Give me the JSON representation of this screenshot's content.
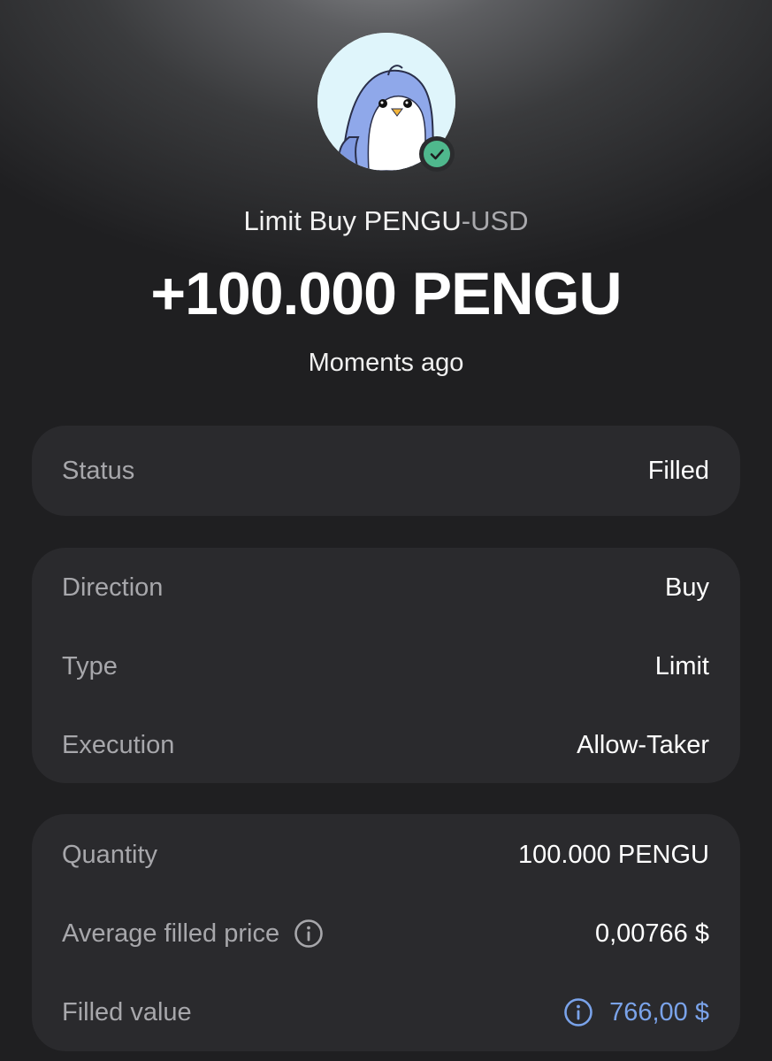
{
  "header": {
    "avatar_icon": "pengu-penguin-avatar",
    "verified_icon": "check-circle-icon",
    "title_pair_base": "Limit Buy PENGU",
    "title_pair_quote": "-USD",
    "amount": "+100.000 PENGU",
    "time": "Moments ago"
  },
  "status_card": {
    "label": "Status",
    "value": "Filled"
  },
  "order_card": {
    "rows": [
      {
        "label": "Direction",
        "value": "Buy"
      },
      {
        "label": "Type",
        "value": "Limit"
      },
      {
        "label": "Execution",
        "value": "Allow-Taker"
      }
    ]
  },
  "fill_card": {
    "rows": [
      {
        "label": "Quantity",
        "value": "100.000 PENGU"
      },
      {
        "label": "Average filled price",
        "value": "0,00766 $",
        "icon": "info-icon"
      },
      {
        "label": "Filled value",
        "value": "766,00 $",
        "icon": "info-icon"
      }
    ]
  },
  "colors": {
    "background": "#1f1f21",
    "card": "#2a2a2d",
    "label": "#a7a7ab",
    "accent": "#7aa3ea",
    "verified": "#4fb88d",
    "avatar_blue": "#8fa8ea"
  }
}
